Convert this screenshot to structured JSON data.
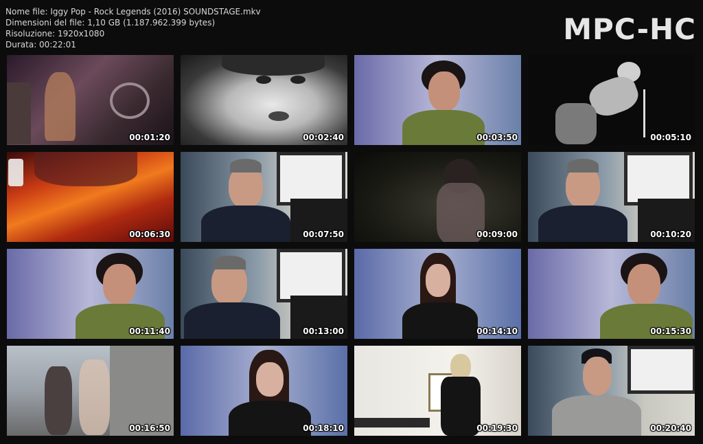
{
  "file_info": {
    "name": "Nome file: Iggy Pop - Rock Legends (2016) SOUNDSTAGE.mkv",
    "size": "Dimensioni del file: 1,10 GB (1.187.962.399 bytes)",
    "resolution": "Risoluzione: 1920x1080",
    "duration": "Durata: 00:22:01"
  },
  "logo": "MPC-HC",
  "thumbnails": [
    {
      "time": "00:01:20"
    },
    {
      "time": "00:02:40"
    },
    {
      "time": "00:03:50"
    },
    {
      "time": "00:05:10"
    },
    {
      "time": "00:06:30"
    },
    {
      "time": "00:07:50"
    },
    {
      "time": "00:09:00"
    },
    {
      "time": "00:10:20"
    },
    {
      "time": "00:11:40"
    },
    {
      "time": "00:13:00"
    },
    {
      "time": "00:14:10"
    },
    {
      "time": "00:15:30"
    },
    {
      "time": "00:16:50"
    },
    {
      "time": "00:18:10"
    },
    {
      "time": "00:19:30"
    },
    {
      "time": "00:20:40"
    }
  ]
}
